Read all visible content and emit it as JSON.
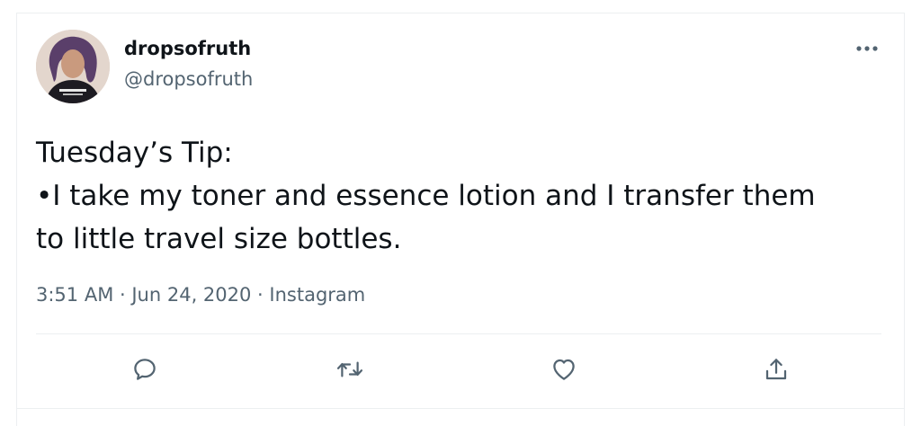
{
  "tweet": {
    "display_name": "dropsofruth",
    "handle": "@dropsofruth",
    "text_lines": [
      "Tuesday’s Tip:",
      "•I take my toner and essence lotion and I transfer them",
      "to little travel size bottles."
    ],
    "time": "3:51 AM",
    "date": "Jun 24, 2020",
    "source": "Instagram",
    "separator": " · "
  },
  "icons": {
    "more": "more-horizontal-icon",
    "reply": "reply-icon",
    "retweet": "retweet-icon",
    "like": "heart-icon",
    "share": "share-icon"
  },
  "colors": {
    "text_primary": "#0f1419",
    "text_secondary": "#536471",
    "divider": "#eceff1"
  }
}
